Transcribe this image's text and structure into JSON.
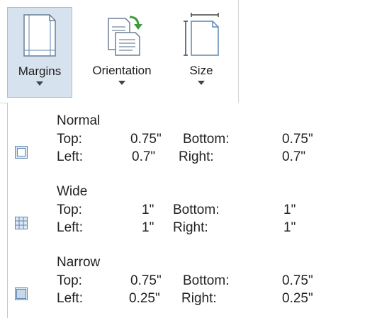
{
  "ribbon": {
    "buttons": [
      {
        "label": "Margins",
        "icon": "margins-icon",
        "active": true
      },
      {
        "label": "Orientation",
        "icon": "orientation-icon",
        "active": false
      },
      {
        "label": "Size",
        "icon": "size-icon",
        "active": false
      }
    ]
  },
  "menu": {
    "items": [
      {
        "name": "Normal",
        "top_label": "Top:",
        "top_value": "0.75\"",
        "bottom_label": "Bottom:",
        "bottom_value": "0.75\"",
        "left_label": "Left:",
        "left_value": "0.7\"",
        "right_label": "Right:",
        "right_value": "0.7\"",
        "icon": "normal-margins-icon"
      },
      {
        "name": "Wide",
        "top_label": "Top:",
        "top_value": "1\"",
        "bottom_label": "Bottom:",
        "bottom_value": "1\"",
        "left_label": "Left:",
        "left_value": "1\"",
        "right_label": "Right:",
        "right_value": "1\"",
        "icon": "wide-margins-icon"
      },
      {
        "name": "Narrow",
        "top_label": "Top:",
        "top_value": "0.75\"",
        "bottom_label": "Bottom:",
        "bottom_value": "0.75\"",
        "left_label": "Left:",
        "left_value": "0.25\"",
        "right_label": "Right:",
        "right_value": "0.25\"",
        "icon": "narrow-margins-icon"
      }
    ]
  },
  "colors": {
    "active_bg": "#d6e2ee",
    "active_border": "#a9bfd6",
    "icon_blue": "#5b87b4",
    "arrow_green": "#3f9a3f"
  }
}
